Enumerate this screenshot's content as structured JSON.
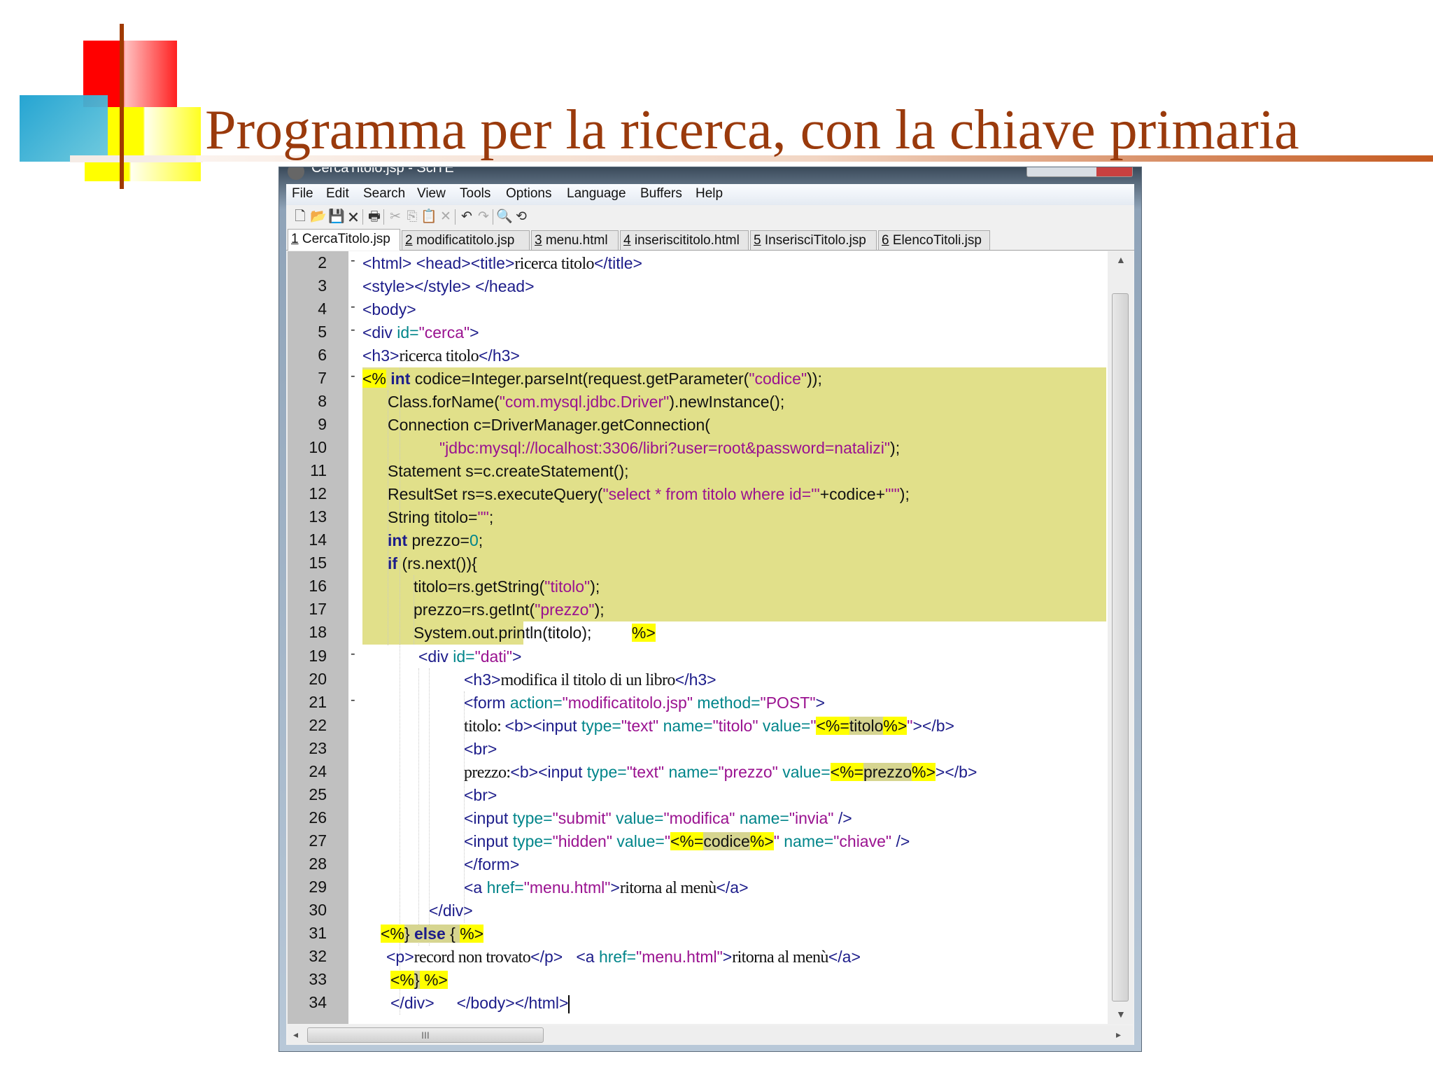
{
  "slide": {
    "title": "Programma per la ricerca, con la chiave primaria"
  },
  "window": {
    "title": "CercaTitolo.jsp - SciTE",
    "menu": [
      "File",
      "Edit",
      "Search",
      "View",
      "Tools",
      "Options",
      "Language",
      "Buffers",
      "Help"
    ],
    "toolbar": [
      {
        "icon": "new-file-icon",
        "glyph": "🗋",
        "enabled": true
      },
      {
        "icon": "open-folder-icon",
        "glyph": "📂",
        "enabled": true
      },
      {
        "icon": "save-icon",
        "glyph": "💾",
        "enabled": false
      },
      {
        "icon": "close-file-icon",
        "glyph": "🗙",
        "enabled": true
      },
      {
        "icon": "print-icon",
        "glyph": "🖶",
        "enabled": true
      },
      {
        "icon": "cut-icon",
        "glyph": "✂",
        "enabled": false
      },
      {
        "icon": "copy-icon",
        "glyph": "⎘",
        "enabled": false
      },
      {
        "icon": "paste-icon",
        "glyph": "📋",
        "enabled": false
      },
      {
        "icon": "delete-icon",
        "glyph": "✕",
        "enabled": false
      },
      {
        "icon": "undo-icon",
        "glyph": "↶",
        "enabled": true
      },
      {
        "icon": "redo-icon",
        "glyph": "↷",
        "enabled": false
      },
      {
        "icon": "find-icon",
        "glyph": "🔍",
        "enabled": true
      },
      {
        "icon": "replace-icon",
        "glyph": "⟲",
        "enabled": true
      }
    ],
    "tabs": [
      {
        "num": "1",
        "name": " CercaTitolo.jsp",
        "active": true
      },
      {
        "num": "2",
        "name": " modificatitolo.jsp",
        "active": false
      },
      {
        "num": "3",
        "name": " menu.html",
        "active": false
      },
      {
        "num": "4",
        "name": " inseriscititolo.html",
        "active": false
      },
      {
        "num": "5",
        "name": " InserisciTitolo.jsp",
        "active": false
      },
      {
        "num": "6",
        "name": " ElencoTitoli.jsp",
        "active": false
      }
    ],
    "hscroll_grip": "III",
    "colors": {
      "highlight_band": "#e1e08a",
      "marker": "#ffff00",
      "tag": "#1c1c8a",
      "attr": "#00858a",
      "string": "#9a1290"
    }
  },
  "code": [
    {
      "n": "2",
      "fold": "-",
      "seg": [
        [
          "tag",
          "<html> <head><title>"
        ],
        [
          "txt",
          "ricerca titolo"
        ],
        [
          "tag",
          "</title>"
        ]
      ]
    },
    {
      "n": "3",
      "fold": "",
      "seg": [
        [
          "tag",
          "<style></style> </head>"
        ]
      ]
    },
    {
      "n": "4",
      "fold": "-",
      "seg": [
        [
          "tag",
          "<body>"
        ]
      ]
    },
    {
      "n": "5",
      "fold": "-",
      "seg": [
        [
          "tag",
          "<div "
        ],
        [
          "attr",
          "id="
        ],
        [
          "str",
          "\"cerca\""
        ],
        [
          "tag",
          ">"
        ]
      ]
    },
    {
      "n": "6",
      "fold": "",
      "seg": [
        [
          "tag",
          "<h3>"
        ],
        [
          "txt",
          "ricerca titolo"
        ],
        [
          "tag",
          "</h3>"
        ]
      ]
    },
    {
      "n": "7",
      "fold": "-",
      "seg": [
        [
          "ybm",
          "<%"
        ],
        [
          "java",
          " "
        ],
        [
          "kw",
          "int"
        ],
        [
          "java",
          " codice=Integer.parseInt(request.getParameter("
        ],
        [
          "str",
          "\"codice\""
        ],
        [
          "java",
          "));"
        ]
      ]
    },
    {
      "n": "8",
      "fold": "",
      "seg": [
        [
          "java",
          "Class.forName("
        ],
        [
          "str",
          "\"com.mysql.jdbc.Driver\""
        ],
        [
          "java",
          ").newInstance();"
        ]
      ]
    },
    {
      "n": "9",
      "fold": "",
      "seg": [
        [
          "java",
          "Connection c=DriverManager.getConnection("
        ]
      ]
    },
    {
      "n": "10",
      "fold": "",
      "seg": [
        [
          "str",
          "\"jdbc:mysql://localhost:3306/libri?user=root&password=natalizi\""
        ],
        [
          "java",
          ");"
        ]
      ]
    },
    {
      "n": "11",
      "fold": "",
      "seg": [
        [
          "java",
          "Statement s=c.createStatement();"
        ]
      ]
    },
    {
      "n": "12",
      "fold": "",
      "seg": [
        [
          "java",
          "ResultSet rs=s.executeQuery("
        ],
        [
          "str",
          "\"select * from titolo where id='\""
        ],
        [
          "java",
          "+codice+"
        ],
        [
          "str",
          "\"'\""
        ],
        [
          "java",
          ");"
        ]
      ]
    },
    {
      "n": "13",
      "fold": "",
      "seg": [
        [
          "java",
          "String titolo="
        ],
        [
          "str",
          "\"\""
        ],
        [
          "java",
          ";"
        ]
      ]
    },
    {
      "n": "14",
      "fold": "",
      "seg": [
        [
          "kw",
          "int"
        ],
        [
          "java",
          " prezzo="
        ],
        [
          "num",
          "0"
        ],
        [
          "java",
          ";"
        ]
      ]
    },
    {
      "n": "15",
      "fold": "",
      "seg": [
        [
          "kw",
          "if"
        ],
        [
          "java",
          " (rs.next()){"
        ]
      ]
    },
    {
      "n": "16",
      "fold": "",
      "seg": [
        [
          "java",
          "titolo=rs.getString("
        ],
        [
          "str",
          "\"titolo\""
        ],
        [
          "java",
          ");"
        ]
      ]
    },
    {
      "n": "17",
      "fold": "",
      "seg": [
        [
          "java",
          "prezzo=rs.getInt("
        ],
        [
          "str",
          "\"prezzo\""
        ],
        [
          "java",
          ");"
        ]
      ]
    },
    {
      "n": "18",
      "fold": "",
      "seg": [
        [
          "java",
          "System.out.println(titolo);         "
        ],
        [
          "ybm",
          "%>"
        ]
      ]
    },
    {
      "n": "19",
      "fold": "-",
      "seg": [
        [
          "tag",
          "<div "
        ],
        [
          "attr",
          "id="
        ],
        [
          "str",
          "\"dati\""
        ],
        [
          "tag",
          ">"
        ]
      ]
    },
    {
      "n": "20",
      "fold": "",
      "seg": [
        [
          "tag",
          "<h3>"
        ],
        [
          "txt",
          "modifica il titolo di un libro"
        ],
        [
          "tag",
          "</h3>"
        ]
      ]
    },
    {
      "n": "21",
      "fold": "-",
      "seg": [
        [
          "tag",
          "<form "
        ],
        [
          "attr",
          "action="
        ],
        [
          "str",
          "\"modificatitolo.jsp\""
        ],
        [
          "attr",
          " method="
        ],
        [
          "str",
          "\"POST\""
        ],
        [
          "tag",
          ">"
        ]
      ]
    },
    {
      "n": "22",
      "fold": "",
      "seg": [
        [
          "txt",
          "titolo: "
        ],
        [
          "tag",
          "<b><input "
        ],
        [
          "attr",
          "type="
        ],
        [
          "str",
          "\"text\""
        ],
        [
          "attr",
          " name="
        ],
        [
          "str",
          "\"titolo\""
        ],
        [
          "attr",
          " value="
        ],
        [
          "str",
          "\""
        ],
        [
          "ybm",
          "<%="
        ],
        [
          "expr",
          "titolo"
        ],
        [
          "ybm",
          "%>"
        ],
        [
          "str",
          "\""
        ],
        [
          "tag",
          "></b>"
        ]
      ]
    },
    {
      "n": "23",
      "fold": "",
      "seg": [
        [
          "tag",
          "<br>"
        ]
      ]
    },
    {
      "n": "24",
      "fold": "",
      "seg": [
        [
          "txt",
          "prezzo:"
        ],
        [
          "tag",
          "<b><input "
        ],
        [
          "attr",
          "type="
        ],
        [
          "str",
          "\"text\""
        ],
        [
          "attr",
          " name="
        ],
        [
          "str",
          "\"prezzo\""
        ],
        [
          "attr",
          " value="
        ],
        [
          "ybm",
          "<%="
        ],
        [
          "expr",
          "prezzo"
        ],
        [
          "ybm",
          "%>"
        ],
        [
          "tag",
          "></b>"
        ]
      ]
    },
    {
      "n": "25",
      "fold": "",
      "seg": [
        [
          "tag",
          "<br>"
        ]
      ]
    },
    {
      "n": "26",
      "fold": "",
      "seg": [
        [
          "tag",
          "<input "
        ],
        [
          "attr",
          "type="
        ],
        [
          "str",
          "\"submit\""
        ],
        [
          "attr",
          " value="
        ],
        [
          "str",
          "\"modifica\""
        ],
        [
          "attr",
          " name="
        ],
        [
          "str",
          "\"invia\""
        ],
        [
          "tag",
          " />"
        ]
      ]
    },
    {
      "n": "27",
      "fold": "",
      "seg": [
        [
          "tag",
          "<input "
        ],
        [
          "attr",
          "type="
        ],
        [
          "str",
          "\"hidden\""
        ],
        [
          "attr",
          " value="
        ],
        [
          "str",
          "\""
        ],
        [
          "ybm",
          "<%="
        ],
        [
          "expr",
          "codice"
        ],
        [
          "ybm",
          "%>"
        ],
        [
          "str",
          "\""
        ],
        [
          "attr",
          " name="
        ],
        [
          "str",
          "\"chiave\""
        ],
        [
          "tag",
          " />"
        ]
      ]
    },
    {
      "n": "28",
      "fold": "",
      "seg": [
        [
          "tag",
          "</form>"
        ]
      ]
    },
    {
      "n": "29",
      "fold": "",
      "seg": [
        [
          "tag",
          "<a "
        ],
        [
          "attr",
          "href="
        ],
        [
          "str",
          "\"menu.html\""
        ],
        [
          "tag",
          ">"
        ],
        [
          "txt",
          "ritorna al menù"
        ],
        [
          "tag",
          "</a>"
        ]
      ]
    },
    {
      "n": "30",
      "fold": "",
      "seg": [
        [
          "tag",
          "</div>"
        ]
      ]
    },
    {
      "n": "31",
      "fold": "",
      "seg": [
        [
          "ybm",
          "<%"
        ],
        [
          "expr",
          "}"
        ],
        [
          "exprkw",
          " else "
        ],
        [
          "expr",
          "{ "
        ],
        [
          "ybm",
          "%>"
        ]
      ]
    },
    {
      "n": "32",
      "fold": "",
      "seg": [
        [
          "tag",
          "<p>"
        ],
        [
          "txt",
          "record non trovato"
        ],
        [
          "tag",
          "</p>   <a "
        ],
        [
          "attr",
          "href="
        ],
        [
          "str",
          "\"menu.html\""
        ],
        [
          "tag",
          ">"
        ],
        [
          "txt",
          "ritorna al menù"
        ],
        [
          "tag",
          "</a>"
        ]
      ]
    },
    {
      "n": "33",
      "fold": "",
      "seg": [
        [
          "ybm",
          "<%"
        ],
        [
          "expr",
          "}"
        ],
        [
          "ybm",
          " %>"
        ]
      ]
    },
    {
      "n": "34",
      "fold": "",
      "seg": [
        [
          "tag",
          "</div>     </body></html>"
        ]
      ]
    }
  ]
}
